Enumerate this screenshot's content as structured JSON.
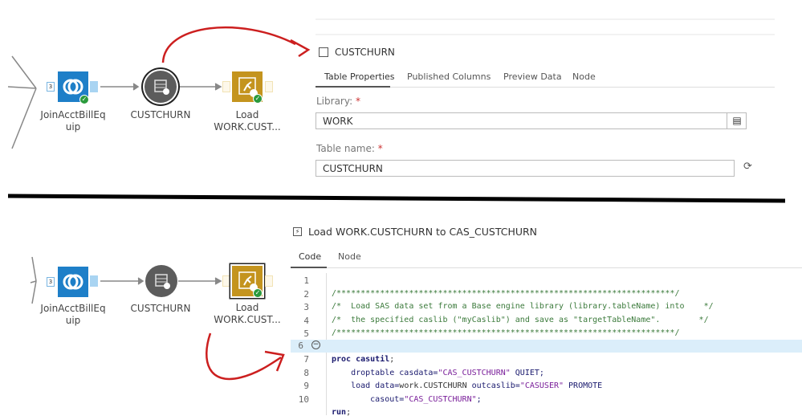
{
  "top_flow": {
    "nodes": [
      {
        "label_line1": "JoinAcctBillEq",
        "label_line2": "uip",
        "input_count": "3"
      },
      {
        "label": "CUSTCHURN"
      },
      {
        "label_line1": "Load",
        "label_line2": "WORK.CUST..."
      }
    ]
  },
  "bottom_flow": {
    "nodes": [
      {
        "label_line1": "JoinAcctBillEq",
        "label_line2": "uip",
        "input_count": "3"
      },
      {
        "label": "CUSTCHURN"
      },
      {
        "label_line1": "Load",
        "label_line2": "WORK.CUST..."
      }
    ]
  },
  "table_panel": {
    "title": "CUSTCHURN",
    "tabs": [
      "Table Properties",
      "Published Columns",
      "Preview Data",
      "Node"
    ],
    "active_tab": "Table Properties",
    "library_label": "Library:",
    "library_value": "WORK",
    "table_name_label": "Table name:",
    "table_name_value": "CUSTCHURN",
    "required_marker": "*"
  },
  "code_panel": {
    "title": "Load WORK.CUSTCHURN to CAS_CUSTCHURN",
    "tabs": [
      "Code",
      "Node"
    ],
    "active_tab": "Code",
    "line_numbers": [
      "1",
      "2",
      "3",
      "4",
      "5",
      "6",
      "7",
      "8",
      "9",
      "10"
    ],
    "highlighted_line": "6",
    "lines": {
      "l1": "/**********************************************************************/",
      "l2": "/*  Load SAS data set from a Base engine library (library.tableName) into    */",
      "l3": "/*  the specified caslib (\"myCaslib\") and save as \"targetTableName\".        */",
      "l4": "/**********************************************************************/",
      "l6a": "proc casutil",
      "l6b": ";",
      "l7a": "    droptable casdata=",
      "l7b": "\"CAS_CUSTCHURN\"",
      "l7c": " QUIET;",
      "l8a": "    load data=",
      "l8b": "work.CUSTCHURN",
      "l8c": " outcaslib=",
      "l8d": "\"CASUSER\"",
      "l8e": " PROMOTE",
      "l9a": "        casout=",
      "l9b": "\"CAS_CUSTCHURN\"",
      "l9c": ";",
      "l10a": "run",
      "l10b": ";"
    }
  },
  "colors": {
    "join_node": "#1e7fc8",
    "load_node": "#c4941e",
    "table_node": "#5c5c5c",
    "annotation_arrow": "#cc1f1f",
    "highlight": "#dbeefa"
  }
}
